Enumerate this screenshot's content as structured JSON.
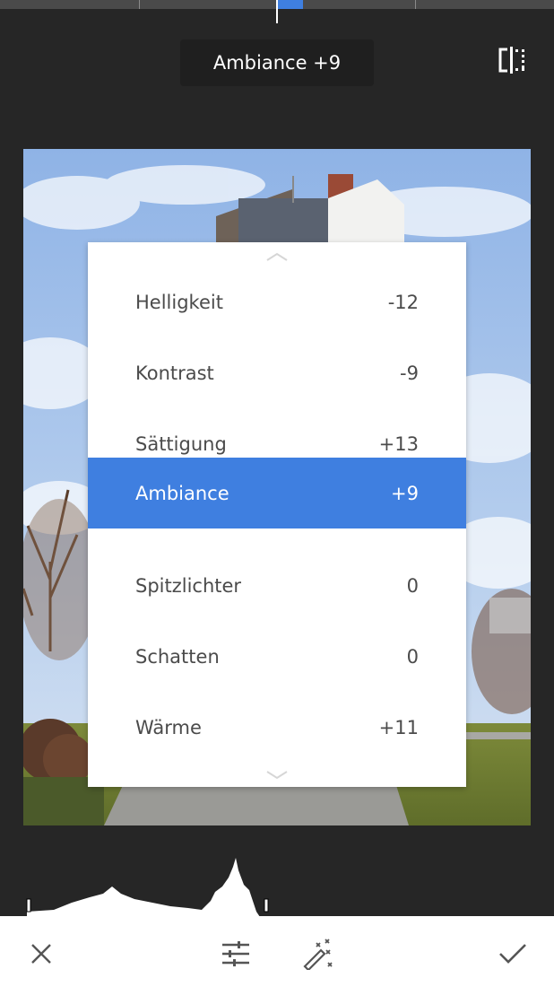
{
  "colors": {
    "background": "#262626",
    "accent": "#3f7fe0",
    "menu_bg": "#ffffff"
  },
  "header": {
    "title": "Ambiance +9",
    "compare_icon": "compare-split-icon"
  },
  "adjust_menu": {
    "items": [
      {
        "label": "Helligkeit",
        "value": "-12"
      },
      {
        "label": "Kontrast",
        "value": "-9"
      },
      {
        "label": "Sättigung",
        "value": "+13"
      },
      {
        "label": "Ambiance",
        "value": "+9",
        "selected": true
      },
      {
        "label": "Spitzlichter",
        "value": "0"
      },
      {
        "label": "Schatten",
        "value": "0"
      },
      {
        "label": "Wärme",
        "value": "+11"
      }
    ],
    "scroll_up_icon": "chevron-up-icon",
    "scroll_down_icon": "chevron-down-icon"
  },
  "toolbar": {
    "cancel_icon": "close-icon",
    "tune_icon": "tune-sliders-icon",
    "auto_icon": "magic-wand-icon",
    "apply_icon": "check-icon"
  }
}
